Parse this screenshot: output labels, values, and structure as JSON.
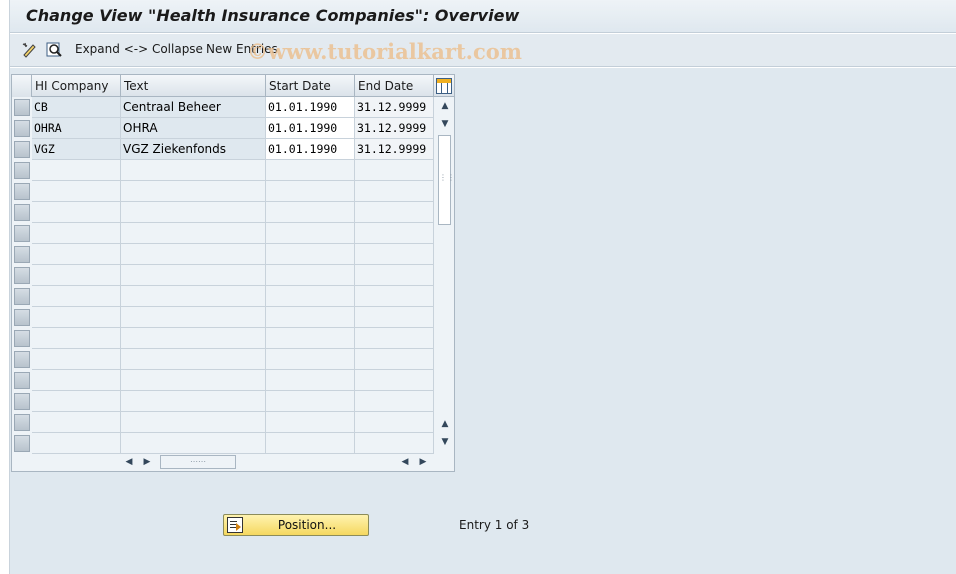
{
  "window": {
    "title": "Change View \"Health Insurance Companies\": Overview"
  },
  "toolbar": {
    "expand_collapse_label": "Expand <-> Collapse",
    "new_entries_label": "New Entries",
    "watermark": "©www.tutorialkart.com"
  },
  "table": {
    "columns": [
      "HI Company",
      "Text",
      "Start Date",
      "End Date"
    ],
    "rows": [
      {
        "hi_company": "CB",
        "text": "Centraal Beheer",
        "start_date": "01.01.1990",
        "end_date": "31.12.9999"
      },
      {
        "hi_company": "OHRA",
        "text": "OHRA",
        "start_date": "01.01.1990",
        "end_date": "31.12.9999"
      },
      {
        "hi_company": "VGZ",
        "text": "VGZ Ziekenfonds",
        "start_date": "01.01.1990",
        "end_date": "31.12.9999"
      }
    ],
    "empty_rows": 14
  },
  "footer": {
    "position_button": "Position...",
    "entry_text": "Entry 1 of 3"
  },
  "colors": {
    "background": "#dfe8ef",
    "button_yellow": "#f5d860"
  }
}
